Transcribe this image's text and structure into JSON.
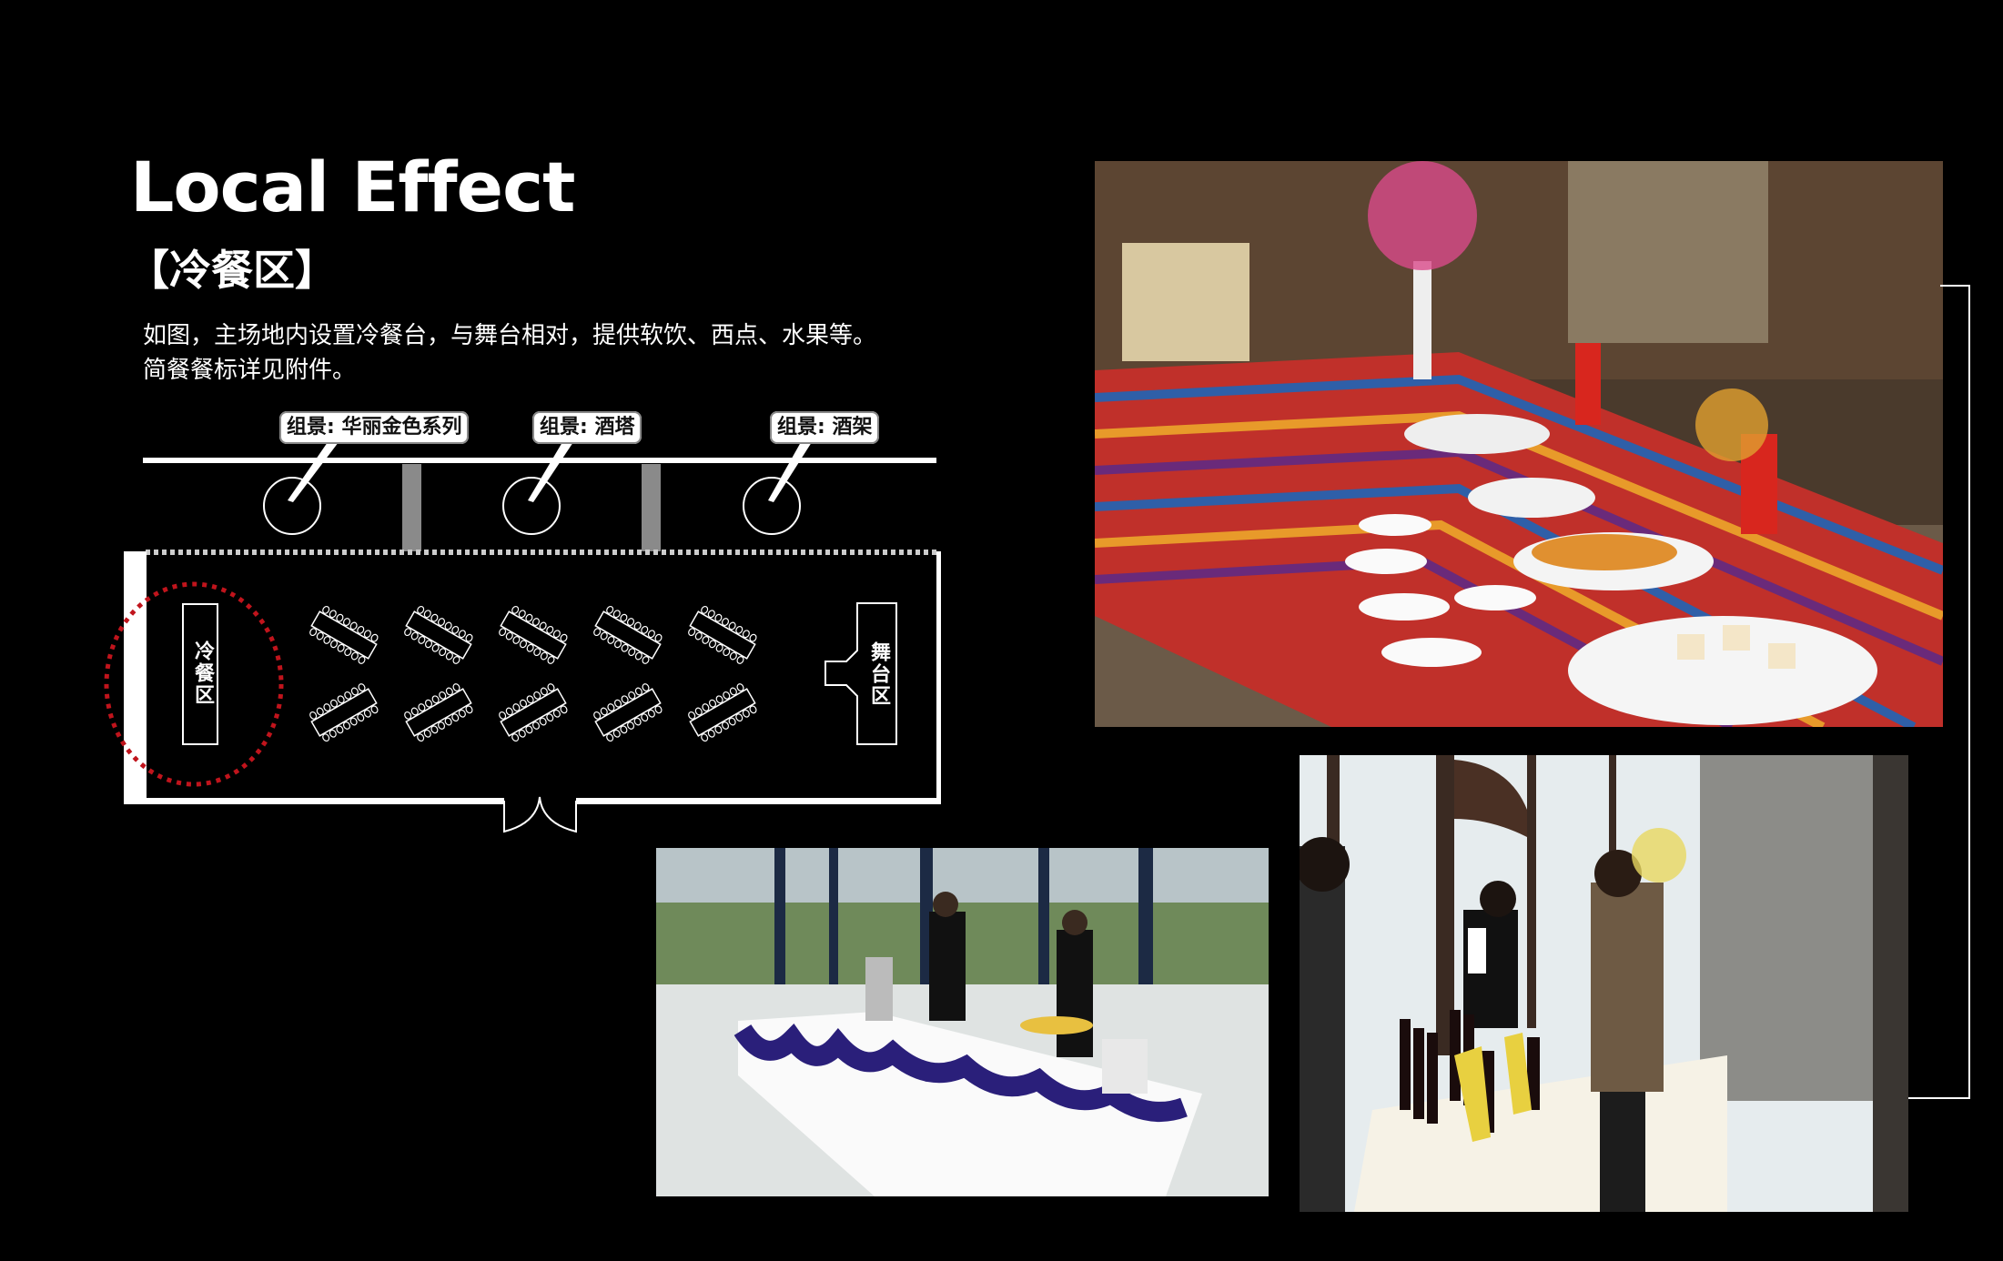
{
  "page": {
    "title": "Local Effect",
    "subtitle": "【冷餐区】",
    "description_lines": [
      "如图，主场地内设置冷餐台，与舞台相对，提供软饮、西点、水果等。",
      "简餐餐标详见附件。"
    ]
  },
  "floor_plan": {
    "callouts": [
      {
        "label": "组景: 华丽金色系列"
      },
      {
        "label": "组景: 酒塔"
      },
      {
        "label": "组景: 酒架"
      }
    ],
    "cold_buffet_label": "冷餐区",
    "stage_label": "舞台区",
    "guest_table_rows": 2,
    "guest_table_columns": 5,
    "highlight_color": "#c0141c"
  },
  "photos": [
    {
      "subject": "buffet-dessert-table-icon"
    },
    {
      "subject": "outdoor-buffet-table-icon"
    },
    {
      "subject": "wine-tasting-table-icon"
    }
  ],
  "colors": {
    "background": "#000000",
    "text": "#ffffff",
    "pillar": "#8a8a8a"
  }
}
